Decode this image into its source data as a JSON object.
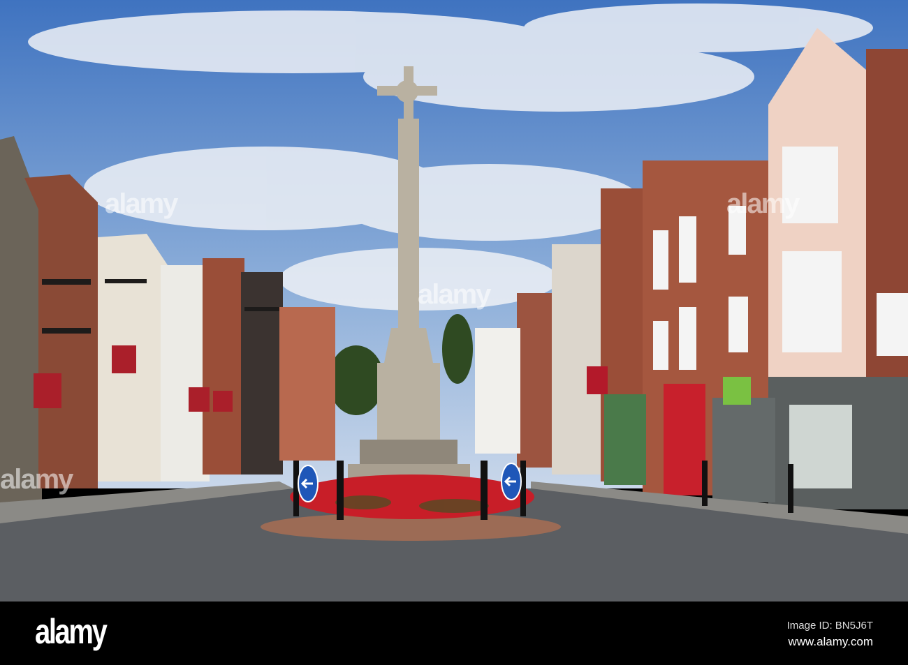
{
  "photo": {
    "subject": "war-memorial-cross-roundabout",
    "colors": {
      "sky": "#4f7fc4",
      "brick": "#9a4e38",
      "road": "#55585c",
      "flowers": "#d8202a",
      "sign_blue": "#1f57b8"
    }
  },
  "watermark": {
    "logo": "alamy",
    "overlay": "alamy"
  },
  "footer": {
    "logo": "alamy",
    "image_id": "Image ID: BN5J6T",
    "url": "www.alamy.com"
  }
}
